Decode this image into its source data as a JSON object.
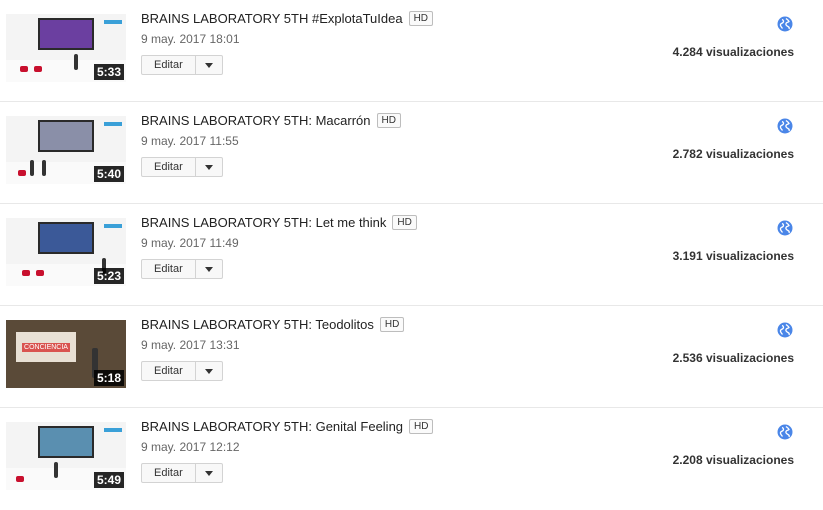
{
  "videos": [
    {
      "title": "BRAINS LABORATORY 5TH #ExplotaTuIdea",
      "badge": "HD",
      "date": "9 may. 2017 18:01",
      "duration": "5:33",
      "edit_label": "Editar",
      "views": "4.284 visualizaciones",
      "thumb_screen_color": "#6b3fa0"
    },
    {
      "title": "BRAINS LABORATORY 5TH: Macarrón",
      "badge": "HD",
      "date": "9 may. 2017 11:55",
      "duration": "5:40",
      "edit_label": "Editar",
      "views": "2.782 visualizaciones",
      "thumb_screen_color": "#8a8fa8"
    },
    {
      "title": "BRAINS LABORATORY 5TH: Let me think",
      "badge": "HD",
      "date": "9 may. 2017 11:49",
      "duration": "5:23",
      "edit_label": "Editar",
      "views": "3.191 visualizaciones",
      "thumb_screen_color": "#3b5998"
    },
    {
      "title": "BRAINS LABORATORY 5TH: Teodolitos",
      "badge": "HD",
      "date": "9 may. 2017 13:31",
      "duration": "5:18",
      "edit_label": "Editar",
      "views": "2.536 visualizaciones",
      "thumb_screen_color": "#e8e0d4",
      "thumb_screen_text": "CONCIENCIA"
    },
    {
      "title": "BRAINS LABORATORY 5TH: Genital Feeling",
      "badge": "HD",
      "date": "9 may. 2017 12:12",
      "duration": "5:49",
      "edit_label": "Editar",
      "views": "2.208 visualizaciones",
      "thumb_screen_color": "#5a8fb0"
    }
  ],
  "icons": {
    "visibility": "globe-icon",
    "menu": "chevron-down-icon"
  },
  "colors": {
    "globe": "#4a86e8",
    "duration_bg": "#000000",
    "badge_border": "#bdbdbd"
  }
}
